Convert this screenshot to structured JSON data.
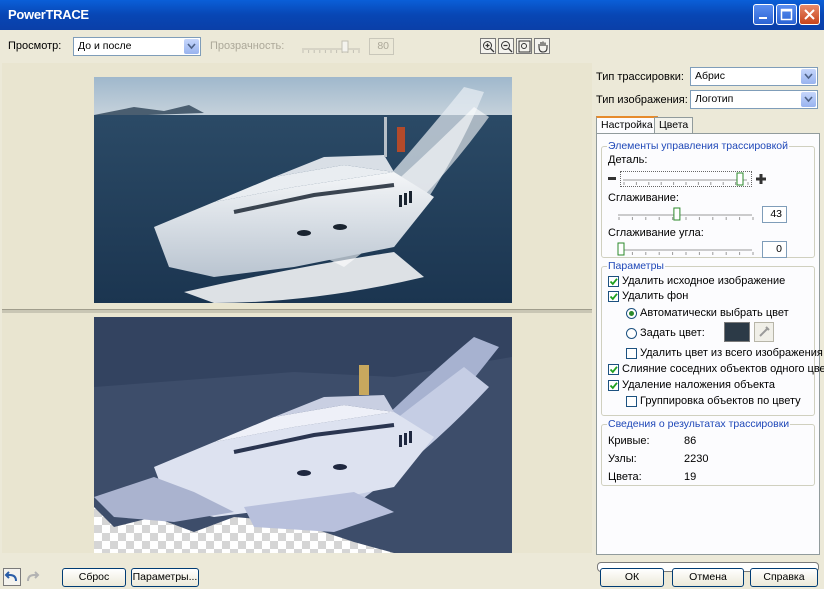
{
  "window": {
    "title": "PowerTRACE"
  },
  "toolbar": {
    "preview_label": "Просмотр:",
    "preview_value": "До и после",
    "transparency_label": "Прозрачность:",
    "transparency_value": "80",
    "transparency_level": 0.8
  },
  "settings": {
    "trace_type_label": "Тип трассировки:",
    "trace_type_value": "Абрис",
    "image_type_label": "Тип изображения:",
    "image_type_value": "Логотип"
  },
  "tabs": [
    {
      "label": "Настройка",
      "active": true
    },
    {
      "label": "Цвета",
      "active": false
    }
  ],
  "controls_group": {
    "title": "Элементы управления трассировкой",
    "detail_label": "Деталь:",
    "detail_level": 0.95,
    "smoothing_label": "Сглаживание:",
    "smoothing_value": "43",
    "corner_label": "Сглаживание угла:",
    "corner_value": "0"
  },
  "params_group": {
    "title": "Параметры",
    "delete_original": "Удалить исходное изображение",
    "remove_background": "Удалить фон",
    "auto_color": "Автоматически выбрать цвет",
    "set_color": "Задать цвет:",
    "remove_color_all": "Удалить цвет из всего изображения",
    "merge_adjacent": "Слияние соседних объектов одного цвета",
    "remove_overlap": "Удаление наложения объекта",
    "group_by_color": "Группировка объектов по цвету",
    "checks": {
      "delete_original": true,
      "remove_background": true,
      "remove_color_all": false,
      "merge_adjacent": true,
      "remove_overlap": true,
      "group_by_color": false
    },
    "color_swatch": "#2c3a47"
  },
  "results_group": {
    "title": "Сведения о результатах трассировки",
    "curves_label": "Кривые:",
    "curves_value": "86",
    "nodes_label": "Узлы:",
    "nodes_value": "2230",
    "colors_label": "Цвета:",
    "colors_value": "19"
  },
  "bottom": {
    "reset": "Сброс",
    "options": "Параметры...",
    "ok": "ОК",
    "cancel": "Отмена",
    "help": "Справка"
  },
  "colors": {
    "title_bar": "#0846b4",
    "accent": "#1f48b8",
    "tab_highlight": "#e68b2c"
  }
}
